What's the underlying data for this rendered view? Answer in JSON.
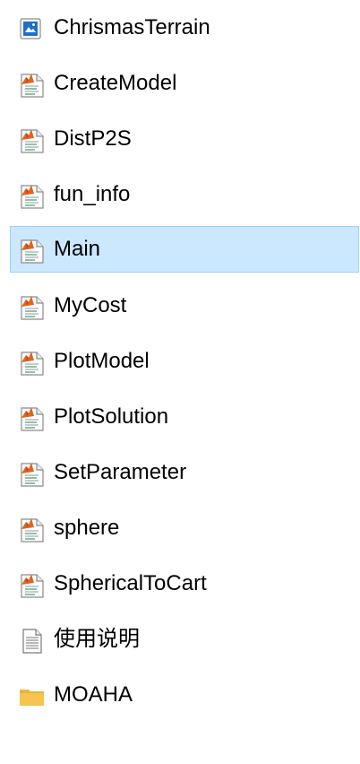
{
  "files": [
    {
      "name": "ChrismasTerrain",
      "icon": "figure-file-icon",
      "selected": false
    },
    {
      "name": "CreateModel",
      "icon": "matlab-script-icon",
      "selected": false
    },
    {
      "name": "DistP2S",
      "icon": "matlab-script-icon",
      "selected": false
    },
    {
      "name": "fun_info",
      "icon": "matlab-script-icon",
      "selected": false
    },
    {
      "name": "Main",
      "icon": "matlab-script-icon",
      "selected": true
    },
    {
      "name": "MyCost",
      "icon": "matlab-script-icon",
      "selected": false
    },
    {
      "name": "PlotModel",
      "icon": "matlab-script-icon",
      "selected": false
    },
    {
      "name": "PlotSolution",
      "icon": "matlab-script-icon",
      "selected": false
    },
    {
      "name": "SetParameter",
      "icon": "matlab-script-icon",
      "selected": false
    },
    {
      "name": "sphere",
      "icon": "matlab-script-icon",
      "selected": false
    },
    {
      "name": "SphericalToCart",
      "icon": "matlab-script-icon",
      "selected": false
    },
    {
      "name": "使用说明",
      "icon": "text-document-icon",
      "selected": false
    },
    {
      "name": "MOAHA",
      "icon": "folder-icon",
      "selected": false
    }
  ],
  "colors": {
    "selection_bg": "#cce8ff",
    "selection_border": "#99d1ff",
    "folder": "#f5c451",
    "figure_blue": "#1e6fc6"
  }
}
